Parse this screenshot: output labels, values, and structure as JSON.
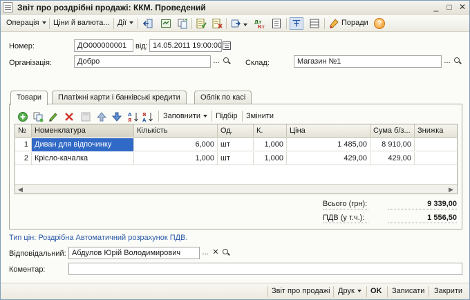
{
  "window": {
    "title": "Звіт про роздрібні продажі: ККМ. Проведений",
    "controls": {
      "minimize": "_",
      "maximize": "□",
      "close": "✕"
    }
  },
  "toolbar": {
    "operation": "Операція",
    "prices": "Ціни й валюта...",
    "actions": "Дії",
    "tips": "Поради",
    "help": "?"
  },
  "form": {
    "number_label": "Номер:",
    "number_value": "ДО000000001",
    "date_label": "від:",
    "date_value": "14.05.2011 19:00:00",
    "org_label": "Організація:",
    "org_value": "Добро",
    "warehouse_label": "Склад:",
    "warehouse_value": "Магазин №1",
    "ellipsis": "..."
  },
  "tabs": [
    {
      "label": "Товари"
    },
    {
      "label": "Платіжні карти і банківські кредити"
    },
    {
      "label": "Облік по касі"
    }
  ],
  "inner_toolbar": {
    "fill": "Заповнити",
    "select": "Підбір",
    "change": "Змінити"
  },
  "table": {
    "headers": [
      "№",
      "Номенклатура",
      "Кількість",
      "Од.",
      "К.",
      "Ціна",
      "Сума б/з...",
      "Знижка"
    ],
    "rows": [
      [
        "1",
        "Диван для відпочинку",
        "6,000",
        "шт",
        "1,000",
        "1 485,00",
        "8 910,00",
        ""
      ],
      [
        "2",
        "Крісло-качалка",
        "1,000",
        "шт",
        "1,000",
        "429,00",
        "429,00",
        ""
      ]
    ]
  },
  "totals": {
    "total_label": "Всього (грн):",
    "total_value": "9 339,00",
    "vat_label": "ПДВ (у т.ч.):",
    "vat_value": "1 556,50"
  },
  "price_type_link": "Тип цін: Роздрібна Автоматичний розрахунок ПДВ.",
  "responsible": {
    "label": "Відповідальний:",
    "value": "Абдулов Юрій Володимирович",
    "clear": "✕"
  },
  "comment": {
    "label": "Коментар:",
    "value": ""
  },
  "footer": {
    "report": "Звіт про продажі",
    "print": "Друк",
    "ok": "OK",
    "save": "Записати",
    "close": "Закрити"
  },
  "colors": {
    "selection": "#3169c6",
    "link": "#2a5aa8"
  }
}
